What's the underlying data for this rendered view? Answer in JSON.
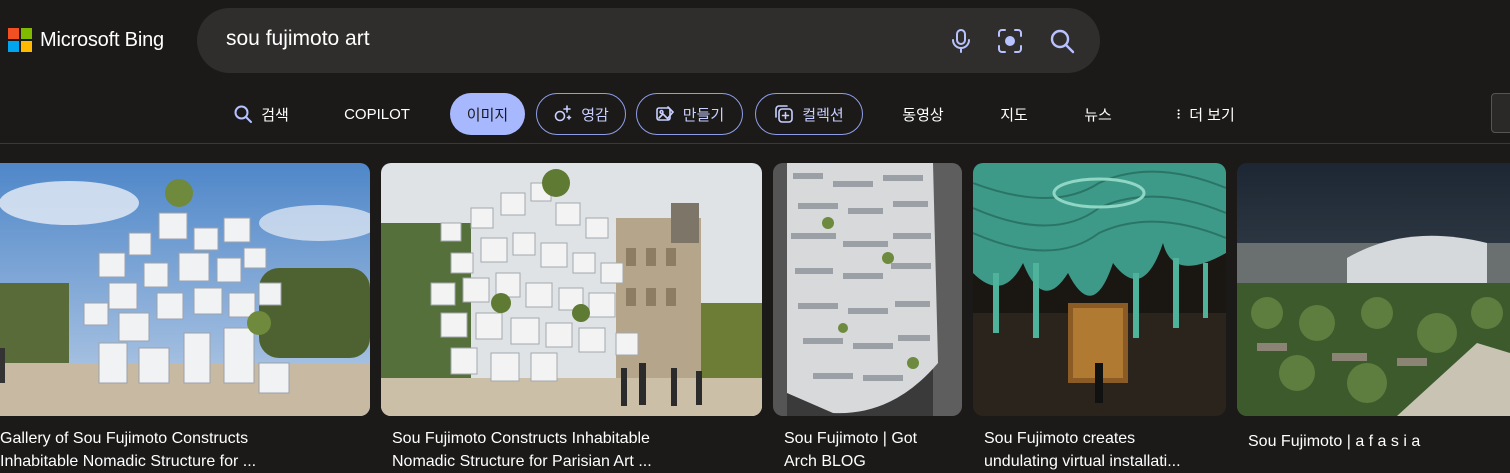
{
  "brand": {
    "name": "Microsoft Bing",
    "square_colors": [
      "#f25022",
      "#7fba00",
      "#00a4ef",
      "#ffb900"
    ]
  },
  "search": {
    "query": "sou fujimoto art",
    "icons": [
      "microphone-icon",
      "visual-search-icon",
      "search-icon"
    ]
  },
  "nav": {
    "items": [
      {
        "label": "검색",
        "icon": "search-icon"
      },
      {
        "label": "COPILOT"
      },
      {
        "label": "이미지",
        "active": true
      },
      {
        "label": "영감",
        "icon": "sparkle-icon"
      },
      {
        "label": "만들기",
        "icon": "image-create-icon"
      },
      {
        "label": "컬렉션",
        "icon": "collection-add-icon"
      },
      {
        "label": "동영상"
      },
      {
        "label": "지도"
      },
      {
        "label": "뉴스"
      },
      {
        "label": "더 보기",
        "icon": "more-vertical-icon"
      }
    ]
  },
  "colors": {
    "background": "#1b1a19",
    "accent": "#a8b8ff",
    "searchbox": "#2f2e2d"
  },
  "results": [
    {
      "caption_line1": "Gallery of Sou Fujimoto Constructs",
      "caption_line2": "Inhabitable Nomadic Structure for ..."
    },
    {
      "caption_line1": "Sou Fujimoto Constructs Inhabitable",
      "caption_line2": "Nomadic Structure for Parisian Art ..."
    },
    {
      "caption_line1": "Sou Fujimoto | Got",
      "caption_line2": "Arch BLOG"
    },
    {
      "caption_line1": "Sou Fujimoto creates",
      "caption_line2": "undulating virtual installati..."
    },
    {
      "caption_line1": "Sou Fujimoto | a f a s i a",
      "caption_line2": ""
    }
  ]
}
